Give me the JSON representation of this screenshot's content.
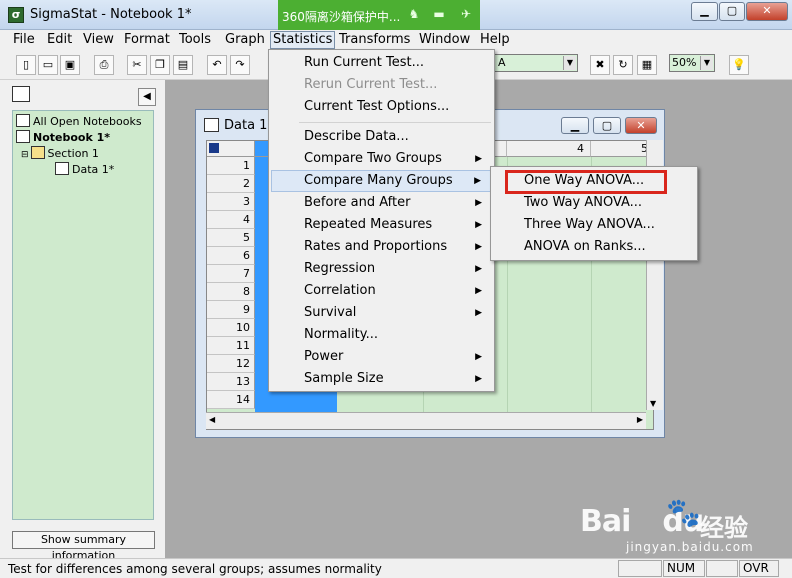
{
  "window": {
    "title": "SigmaStat - Notebook 1*",
    "security_banner": "360隔离沙箱保护中...",
    "controls": [
      "minimize",
      "maximize",
      "close"
    ]
  },
  "menubar": {
    "items": [
      {
        "label": "File"
      },
      {
        "label": "Edit"
      },
      {
        "label": "View"
      },
      {
        "label": "Format"
      },
      {
        "label": "Tools"
      },
      {
        "label": "Graph"
      },
      {
        "label": "Statistics"
      },
      {
        "label": "Transforms"
      },
      {
        "label": "Window"
      },
      {
        "label": "Help"
      }
    ],
    "active": "Statistics"
  },
  "toolbar": {
    "zoom_value": "50%",
    "combo_value": "A"
  },
  "notebook_tree": {
    "items": [
      {
        "label": "All Open Notebooks",
        "bold": false
      },
      {
        "label": "Notebook 1*",
        "bold": true
      },
      {
        "label": "Section 1",
        "bold": false
      },
      {
        "label": "Data 1*",
        "bold": false
      }
    ],
    "summary_button": "Show summary information"
  },
  "data_window": {
    "title": "Data 1*",
    "column_headers": [
      "4",
      "5"
    ],
    "row_numbers": [
      "1",
      "2",
      "3",
      "4",
      "5",
      "6",
      "7",
      "8",
      "9",
      "10",
      "11",
      "12",
      "13",
      "14"
    ]
  },
  "statistics_menu": {
    "items": [
      {
        "label": "Run Current Test...",
        "disabled": false,
        "submenu": false
      },
      {
        "label": "Rerun Current Test...",
        "disabled": true,
        "submenu": false
      },
      {
        "label": "Current Test Options...",
        "disabled": false,
        "submenu": false
      },
      {
        "label": "Describe Data...",
        "disabled": false,
        "submenu": false
      },
      {
        "label": "Compare Two Groups",
        "disabled": false,
        "submenu": true
      },
      {
        "label": "Compare Many Groups",
        "disabled": false,
        "submenu": true,
        "highlighted": true
      },
      {
        "label": "Before and After",
        "disabled": false,
        "submenu": true
      },
      {
        "label": "Repeated Measures",
        "disabled": false,
        "submenu": true
      },
      {
        "label": "Rates and Proportions",
        "disabled": false,
        "submenu": true
      },
      {
        "label": "Regression",
        "disabled": false,
        "submenu": true
      },
      {
        "label": "Correlation",
        "disabled": false,
        "submenu": true
      },
      {
        "label": "Survival",
        "disabled": false,
        "submenu": true
      },
      {
        "label": "Normality...",
        "disabled": false,
        "submenu": false
      },
      {
        "label": "Power",
        "disabled": false,
        "submenu": true
      },
      {
        "label": "Sample Size",
        "disabled": false,
        "submenu": true
      }
    ]
  },
  "compare_many_submenu": {
    "items": [
      {
        "label": "One Way ANOVA...",
        "emphasized": true
      },
      {
        "label": "Two Way ANOVA..."
      },
      {
        "label": "Three Way ANOVA..."
      },
      {
        "label": "ANOVA on Ranks..."
      }
    ],
    "emphasis_color": "#d9261c"
  },
  "statusbar": {
    "text": "Test for differences among several groups; assumes normality",
    "num": "NUM",
    "ovr": "OVR"
  },
  "watermark": {
    "logo": "Bai",
    "logo_suffix": "du",
    "cn": "经验",
    "url": "jingyan.baidu.com"
  }
}
